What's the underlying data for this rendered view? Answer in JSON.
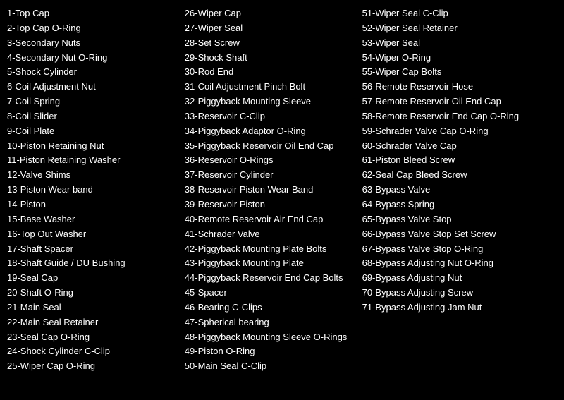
{
  "columns": {
    "col1": {
      "items": [
        "1-Top Cap",
        "2-Top Cap O-Ring",
        "3-Secondary Nuts",
        "4-Secondary Nut O-Ring",
        "5-Shock Cylinder",
        "6-Coil Adjustment Nut",
        "7-Coil Spring",
        "8-Coil Slider",
        "9-Coil Plate",
        "10-Piston Retaining Nut",
        "11-Piston Retaining Washer",
        "12-Valve Shims",
        "13-Piston Wear band",
        "14-Piston",
        "15-Base Washer",
        "16-Top Out Washer",
        "17-Shaft Spacer",
        "18-Shaft Guide / DU Bushing",
        "19-Seal Cap",
        "20-Shaft O-Ring",
        "21-Main Seal",
        "22-Main Seal Retainer",
        "23-Seal Cap O-Ring",
        "24-Shock Cylinder C-Clip",
        "25-Wiper Cap O-Ring"
      ]
    },
    "col2": {
      "items": [
        "26-Wiper Cap",
        "27-Wiper Seal",
        "28-Set Screw",
        "29-Shock Shaft",
        "30-Rod End",
        "31-Coil Adjustment Pinch Bolt",
        "32-Piggyback Mounting Sleeve",
        "33-Reservoir C-Clip",
        "34-Piggyback Adaptor O-Ring",
        "35-Piggyback Reservoir Oil End Cap",
        "36-Reservoir O-Rings",
        "37-Reservoir Cylinder",
        "38-Reservoir Piston Wear Band",
        "39-Reservoir Piston",
        "40-Remote Reservoir Air End Cap",
        "41-Schrader Valve",
        "42-Piggyback Mounting Plate Bolts",
        "43-Piggyback Mounting Plate",
        "44-Piggyback Reservoir End Cap Bolts",
        "45-Spacer",
        "46-Bearing C-Clips",
        "47-Spherical bearing",
        "48-Piggyback Mounting Sleeve O-Rings",
        "49-Piston O-Ring",
        "50-Main Seal C-Clip"
      ]
    },
    "col3": {
      "items": [
        "51-Wiper Seal C-Clip",
        "52-Wiper Seal Retainer",
        "53-Wiper Seal",
        "54-Wiper O-Ring",
        "55-Wiper Cap Bolts",
        "56-Remote Reservoir Hose",
        "57-Remote Reservoir Oil End Cap",
        "58-Remote Reservoir End Cap O-Ring",
        "59-Schrader Valve Cap O-Ring",
        "60-Schrader Valve Cap",
        "61-Piston Bleed Screw",
        "62-Seal Cap Bleed Screw",
        "63-Bypass Valve",
        "64-Bypass Spring",
        "65-Bypass Valve Stop",
        "66-Bypass Valve Stop Set Screw",
        "67-Bypass Valve Stop O-Ring",
        "68-Bypass Adjusting Nut O-Ring",
        "69-Bypass Adjusting Nut",
        "70-Bypass Adjusting Screw",
        "71-Bypass Adjusting Jam Nut"
      ]
    }
  }
}
